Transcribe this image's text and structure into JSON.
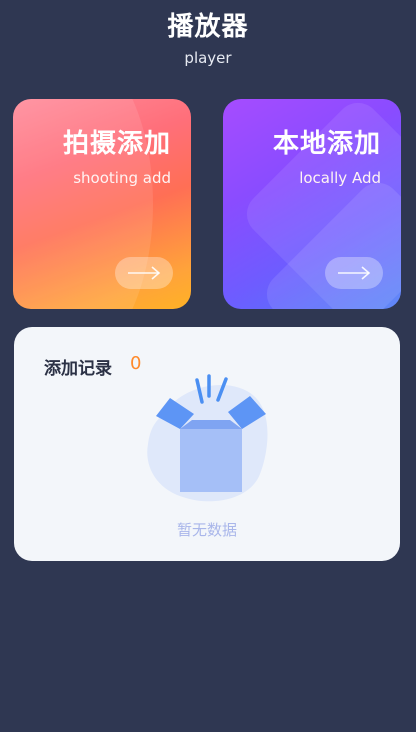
{
  "header": {
    "title": "播放器",
    "subtitle": "player"
  },
  "cards": [
    {
      "title": "拍摄添加",
      "subtitle": "shooting add",
      "icon": "arrow-right-icon"
    },
    {
      "title": "本地添加",
      "subtitle": "locally Add",
      "icon": "arrow-right-icon"
    }
  ],
  "records": {
    "label": "添加记录",
    "count": "0",
    "empty_text": "暂无数据",
    "empty_icon": "empty-box-icon"
  },
  "colors": {
    "background": "#2f3752",
    "count_accent": "#ff8a2b",
    "empty_text": "#a9b6ea"
  }
}
